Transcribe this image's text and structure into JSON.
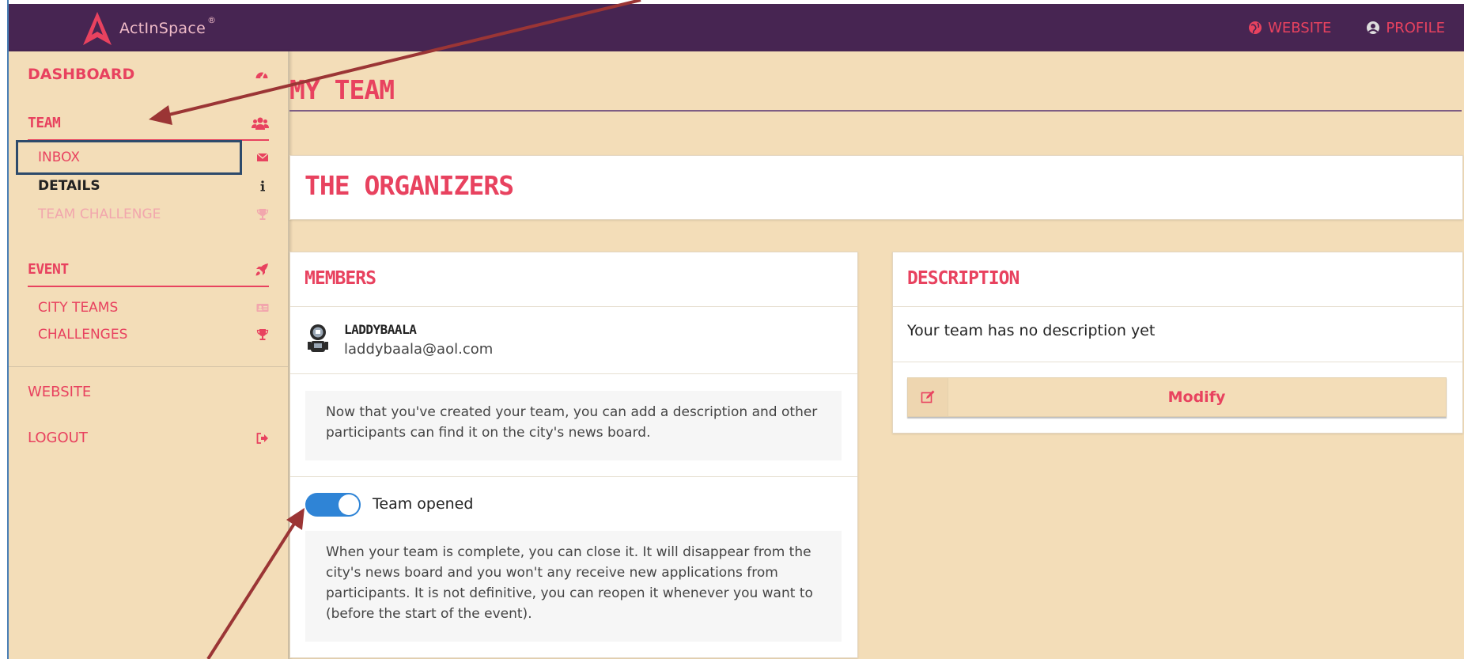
{
  "header": {
    "logo_text": "ActInSpace",
    "logo_reg": "®",
    "nav": [
      {
        "label": "WEBSITE",
        "icon": "globe-icon"
      },
      {
        "label": "PROFILE",
        "icon": "user-circle-icon"
      }
    ]
  },
  "sidebar": {
    "dashboard": {
      "label": "DASHBOARD",
      "icon": "dashboard-icon"
    },
    "team": {
      "label": "TEAM",
      "icon": "users-icon",
      "items": [
        {
          "label": "INBOX",
          "icon": "envelope-icon"
        },
        {
          "label": "DETAILS",
          "icon": "info-icon"
        },
        {
          "label": "TEAM CHALLENGE",
          "icon": "trophy-icon"
        }
      ]
    },
    "event": {
      "label": "EVENT",
      "icon": "rocket-icon",
      "items": [
        {
          "label": "CITY TEAMS",
          "icon": "id-card-icon"
        },
        {
          "label": "CHALLENGES",
          "icon": "trophy-icon"
        }
      ]
    },
    "website": "WEBSITE",
    "logout": {
      "label": "LOGOUT",
      "icon": "sign-out-icon"
    }
  },
  "main": {
    "page_title": "MY TEAM",
    "team_name": "THE ORGANIZERS",
    "members": {
      "title": "MEMBERS",
      "list": [
        {
          "name": "LADDYBAALA",
          "email": "laddybaala@aol.com"
        }
      ],
      "info": "Now that you've created your team, you can add a description and other participants can find it on the city's news board.",
      "toggle_label": "Team opened",
      "toggle_on": true,
      "close_info": "When your team is complete, you can close it. It will disappear from the city's news board and you won't any receive new applications from participants. It is not definitive, you can reopen it whenever you want to (before the start of the event)."
    },
    "description": {
      "title": "DESCRIPTION",
      "text": "Your team has no description yet",
      "modify_label": "Modify"
    }
  },
  "colors": {
    "accent": "#e8425f",
    "header_bg": "#472552",
    "page_bg": "#f3ddb8",
    "toggle": "#2f84d6",
    "annotation_arrow": "#9b3535",
    "highlight_box": "#2d4a6b"
  }
}
